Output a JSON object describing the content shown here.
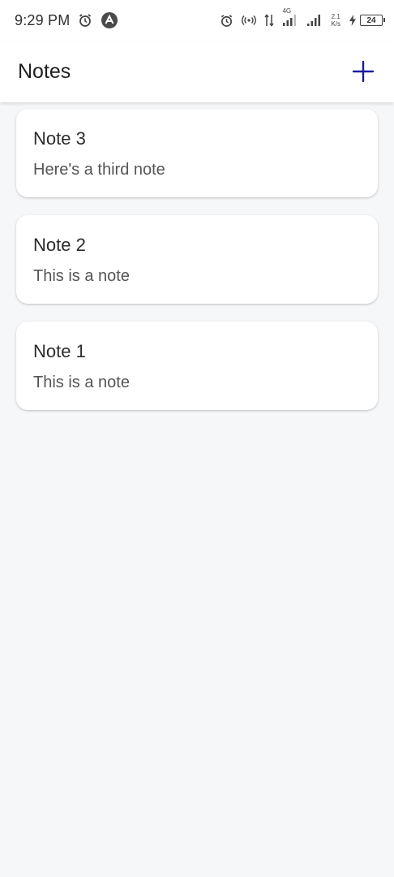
{
  "status_bar": {
    "time": "9:29 PM",
    "network_type": "4G",
    "speed_value": "2.1",
    "speed_unit": "K/s",
    "battery": "24",
    "icons": [
      "alarm-icon",
      "app-notification-icon",
      "alarm-icon",
      "hotspot-icon",
      "data-transfer-icon",
      "signal-icon",
      "signal-icon",
      "charging-icon",
      "battery-icon"
    ]
  },
  "header": {
    "title": "Notes",
    "add_icon": "plus-icon",
    "accent_color": "#1a1aa6"
  },
  "notes": [
    {
      "title": "Note 3",
      "body": "Here's a third note"
    },
    {
      "title": "Note 2",
      "body": "This is a note"
    },
    {
      "title": "Note 1",
      "body": "This is a note"
    }
  ]
}
